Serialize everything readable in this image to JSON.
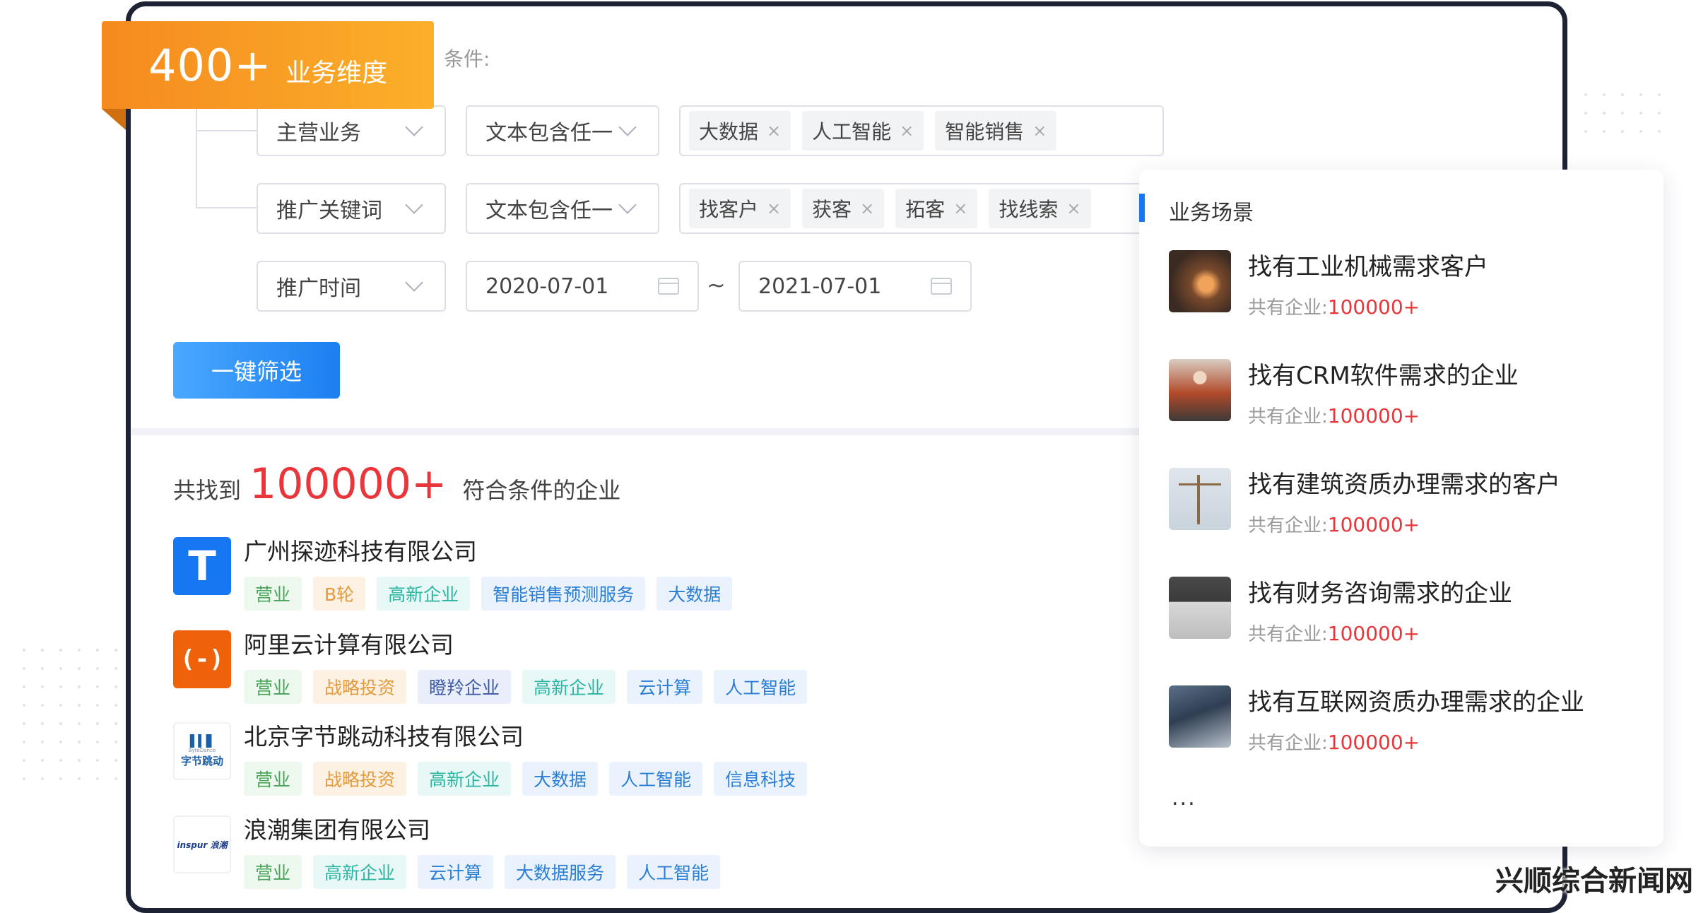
{
  "header": {
    "badge_number": "400+",
    "badge_text": "业务维度",
    "condition_label": "条件:"
  },
  "filters": {
    "row1": {
      "field": "主营业务",
      "operator": "文本包含任一",
      "chips": [
        "大数据",
        "人工智能",
        "智能销售"
      ]
    },
    "row2": {
      "field": "推广关键词",
      "operator": "文本包含任一",
      "chips": [
        "找客户",
        "获客",
        "拓客",
        "找线索"
      ]
    },
    "row3": {
      "field": "推广时间",
      "date_from": "2020-07-01",
      "separator": "~",
      "date_to": "2021-07-01"
    },
    "chip_remove_glyph": "×",
    "submit_label": "一键筛选"
  },
  "results": {
    "prefix": "共找到",
    "count": "100000+",
    "suffix": "符合条件的企业",
    "companies": [
      {
        "name": "广州探迹科技有限公司",
        "logo_text": "T",
        "tags": [
          "营业",
          "B轮",
          "高新企业",
          "智能销售预测服务",
          "大数据"
        ]
      },
      {
        "name": "阿里云计算有限公司",
        "logo_text": "(-)",
        "tags": [
          "营业",
          "战略投资",
          "瞪羚企业",
          "高新企业",
          "云计算",
          "人工智能"
        ]
      },
      {
        "name": "北京字节跳动科技有限公司",
        "logo_text": "字节跳动",
        "logo_small": "ByteDance",
        "tags": [
          "营业",
          "战略投资",
          "高新企业",
          "大数据",
          "人工智能",
          "信息科技"
        ]
      },
      {
        "name": "浪潮集团有限公司",
        "logo_text": "inspur 浪潮",
        "tags": [
          "营业",
          "高新企业",
          "云计算",
          "大数据服务",
          "人工智能"
        ]
      }
    ]
  },
  "scenes": {
    "title": "业务场景",
    "count_label": "共有企业:",
    "items": [
      {
        "title": "找有工业机械需求客户",
        "count": "100000+"
      },
      {
        "title": "找有CRM软件需求的企业",
        "count": "100000+"
      },
      {
        "title": "找有建筑资质办理需求的客户",
        "count": "100000+"
      },
      {
        "title": "找有财务咨询需求的企业",
        "count": "100000+"
      },
      {
        "title": "找有互联网资质办理需求的企业",
        "count": "100000+"
      }
    ],
    "more": "..."
  },
  "watermark": "兴顺综合新闻网",
  "colors": {
    "accent_blue": "#1677f2",
    "accent_red": "#e8363b",
    "badge_orange": "#f7951f",
    "frame": "#1e2235"
  },
  "icons": [
    "chevron-down-icon",
    "calendar-icon",
    "close-icon"
  ]
}
